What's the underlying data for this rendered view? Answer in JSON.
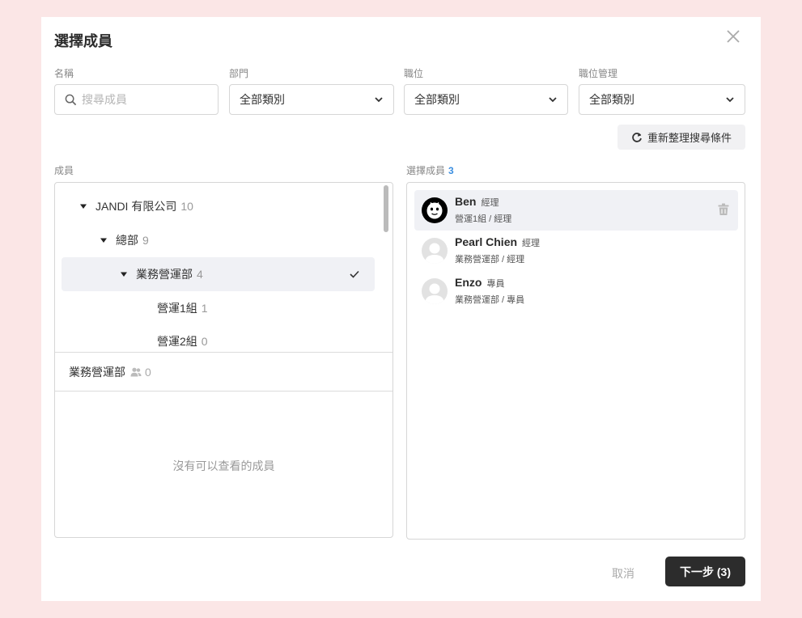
{
  "dialog": {
    "title": "選擇成員"
  },
  "filters": {
    "name": {
      "label": "名稱",
      "placeholder": "搜尋成員"
    },
    "department": {
      "label": "部門",
      "value": "全部類別"
    },
    "position": {
      "label": "職位",
      "value": "全部類別"
    },
    "position_management": {
      "label": "職位管理",
      "value": "全部類別"
    },
    "reset_label": "重新整理搜尋條件"
  },
  "members_panel": {
    "label": "成員",
    "tree": [
      {
        "label": "JANDI 有限公司",
        "count": "10"
      },
      {
        "label": "總部",
        "count": "9"
      },
      {
        "label": "業務營運部",
        "count": "4"
      },
      {
        "label": "營運1組",
        "count": "1"
      },
      {
        "label": "營運2組",
        "count": "0"
      }
    ],
    "selected_dept": {
      "label": "業務營運部",
      "count": "0"
    },
    "empty_message": "沒有可以查看的成員"
  },
  "selected_panel": {
    "label": "選擇成員",
    "count": "3",
    "members": [
      {
        "name": "Ben",
        "role": "經理",
        "detail": "營運1組 / 經理"
      },
      {
        "name": "Pearl Chien",
        "role": "經理",
        "detail": "業務營運部 / 經理"
      },
      {
        "name": "Enzo",
        "role": "專員",
        "detail": "業務營運部 / 專員"
      }
    ]
  },
  "footer": {
    "cancel_label": "取消",
    "next_label": "下一步 (3)"
  },
  "colors": {
    "background": "#fbe6e6",
    "primary_button": "#2c2c2c",
    "accent": "#3b8ee0",
    "selection": "#f0f1f5"
  }
}
